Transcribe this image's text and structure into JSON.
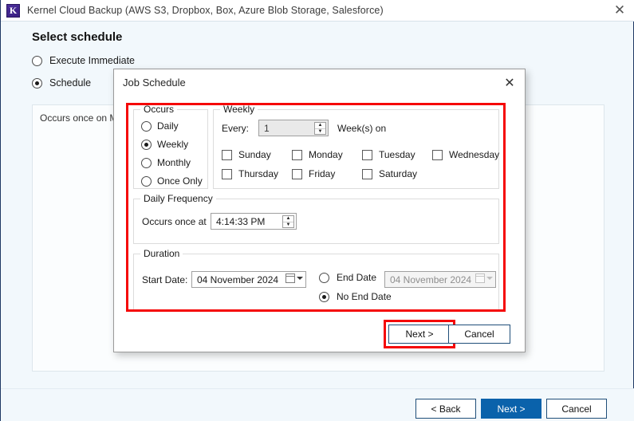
{
  "window": {
    "title": "Kernel Cloud Backup (AWS S3, Dropbox, Box, Azure Blob Storage, Salesforce)",
    "app_icon_letter": "K",
    "close_glyph": "✕"
  },
  "page": {
    "heading": "Select schedule",
    "options": [
      {
        "label": "Execute Immediate",
        "selected": false
      },
      {
        "label": "Schedule",
        "selected": true
      }
    ],
    "summary_text": "Occurs once on Mo"
  },
  "footer": {
    "back_label": "< Back",
    "next_label": "Next >",
    "cancel_label": "Cancel"
  },
  "dialog": {
    "title": "Job Schedule",
    "close_glyph": "✕",
    "occurs": {
      "legend": "Occurs",
      "items": [
        {
          "label": "Daily",
          "selected": false
        },
        {
          "label": "Weekly",
          "selected": true
        },
        {
          "label": "Monthly",
          "selected": false
        },
        {
          "label": "Once Only",
          "selected": false
        }
      ]
    },
    "weekly": {
      "legend": "Weekly",
      "every_label": "Every:",
      "every_value": "1",
      "weeks_on_label": "Week(s) on",
      "days": [
        {
          "label": "Sunday",
          "checked": false
        },
        {
          "label": "Monday",
          "checked": false
        },
        {
          "label": "Tuesday",
          "checked": false
        },
        {
          "label": "Wednesday",
          "checked": false
        },
        {
          "label": "Thursday",
          "checked": false
        },
        {
          "label": "Friday",
          "checked": false
        },
        {
          "label": "Saturday",
          "checked": false
        }
      ]
    },
    "daily_frequency": {
      "legend": "Daily Frequency",
      "occurs_once_label": "Occurs once at",
      "time_value": "4:14:33 PM"
    },
    "duration": {
      "legend": "Duration",
      "start_date_label": "Start Date:",
      "start_date_value": "04 November 2024",
      "end_date_label": "End Date",
      "end_date_value": "04 November 2024",
      "no_end_date_label": "No End Date",
      "end_date_selected": false,
      "no_end_date_selected": true
    },
    "buttons": {
      "next_label": "Next >",
      "cancel_label": "Cancel"
    }
  },
  "colors": {
    "highlight": "#f50707",
    "primary_button": "#0a62ab",
    "window_border": "#1f3864"
  }
}
